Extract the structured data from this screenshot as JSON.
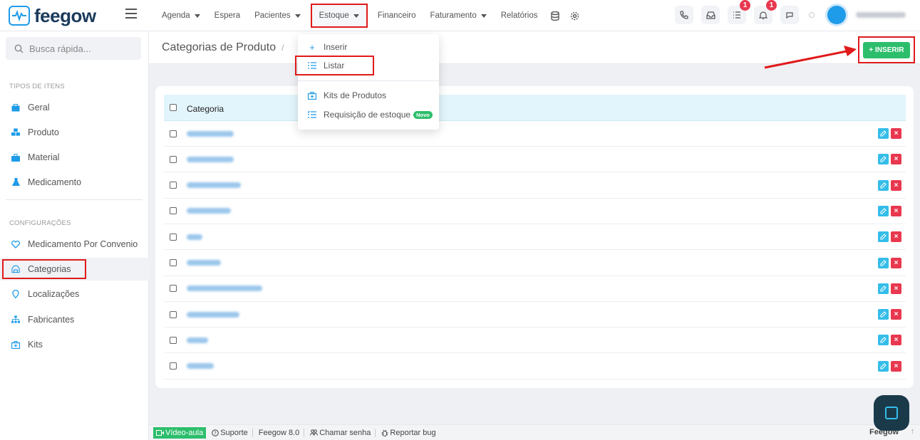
{
  "app": {
    "logo_text": "feegow"
  },
  "nav": {
    "items": [
      {
        "label": "Agenda",
        "has_caret": true
      },
      {
        "label": "Espera",
        "has_caret": false
      },
      {
        "label": "Pacientes",
        "has_caret": true
      },
      {
        "label": "Estoque",
        "has_caret": true,
        "active": true
      },
      {
        "label": "Financeiro",
        "has_caret": false
      },
      {
        "label": "Faturamento",
        "has_caret": true
      },
      {
        "label": "Relatórios",
        "has_caret": false
      }
    ],
    "icons": [
      "database-icon",
      "gear-icon"
    ]
  },
  "topright": {
    "buttons": [
      {
        "icon": "phone-icon",
        "badge": ""
      },
      {
        "icon": "inbox-icon",
        "badge": ""
      },
      {
        "icon": "tasks-icon",
        "badge": "1"
      },
      {
        "icon": "bell-icon",
        "badge": "1"
      },
      {
        "icon": "chat-icon",
        "badge": ""
      }
    ]
  },
  "sidebar": {
    "search_placeholder": "Busca rápida...",
    "section1_title": "TIPOS DE ITENS",
    "section1_items": [
      {
        "label": "Geral",
        "icon": "box-icon"
      },
      {
        "label": "Produto",
        "icon": "products-icon"
      },
      {
        "label": "Material",
        "icon": "briefcase-icon"
      },
      {
        "label": "Medicamento",
        "icon": "flask-icon"
      }
    ],
    "section2_title": "CONFIGURAÇÕES",
    "section2_items": [
      {
        "label": "Medicamento Por Convenio",
        "icon": "heart-shield-icon"
      },
      {
        "label": "Categorias",
        "icon": "categories-icon",
        "active": true
      },
      {
        "label": "Localizações",
        "icon": "location-icon"
      },
      {
        "label": "Fabricantes",
        "icon": "org-chart-icon"
      },
      {
        "label": "Kits",
        "icon": "kit-icon"
      }
    ]
  },
  "page": {
    "title": "Categorias de Produto",
    "breadcrumb_sep": "/",
    "insert_button": "+ INSERIR"
  },
  "dropdown": {
    "items": [
      {
        "label": "Inserir",
        "icon": "plus-icon"
      },
      {
        "label": "Listar",
        "icon": "list-icon",
        "active": true
      },
      {
        "label": "Kits de Produtos",
        "icon": "kit-icon"
      },
      {
        "label": "Requisição de estoque",
        "icon": "checklist-icon",
        "badge": "Novo"
      }
    ]
  },
  "table": {
    "header": "Categoria",
    "rows": 10
  },
  "footer": {
    "video": "Vídeo-aula",
    "support": "Suporte",
    "version": "Feegow 8.0",
    "call": "Chamar senha",
    "bug": "Reportar bug",
    "brand": "Feegow"
  },
  "colors": {
    "accent": "#1e9be9",
    "success": "#2dbe6c",
    "danger": "#e8384f",
    "highlight": "#e01a1a"
  }
}
